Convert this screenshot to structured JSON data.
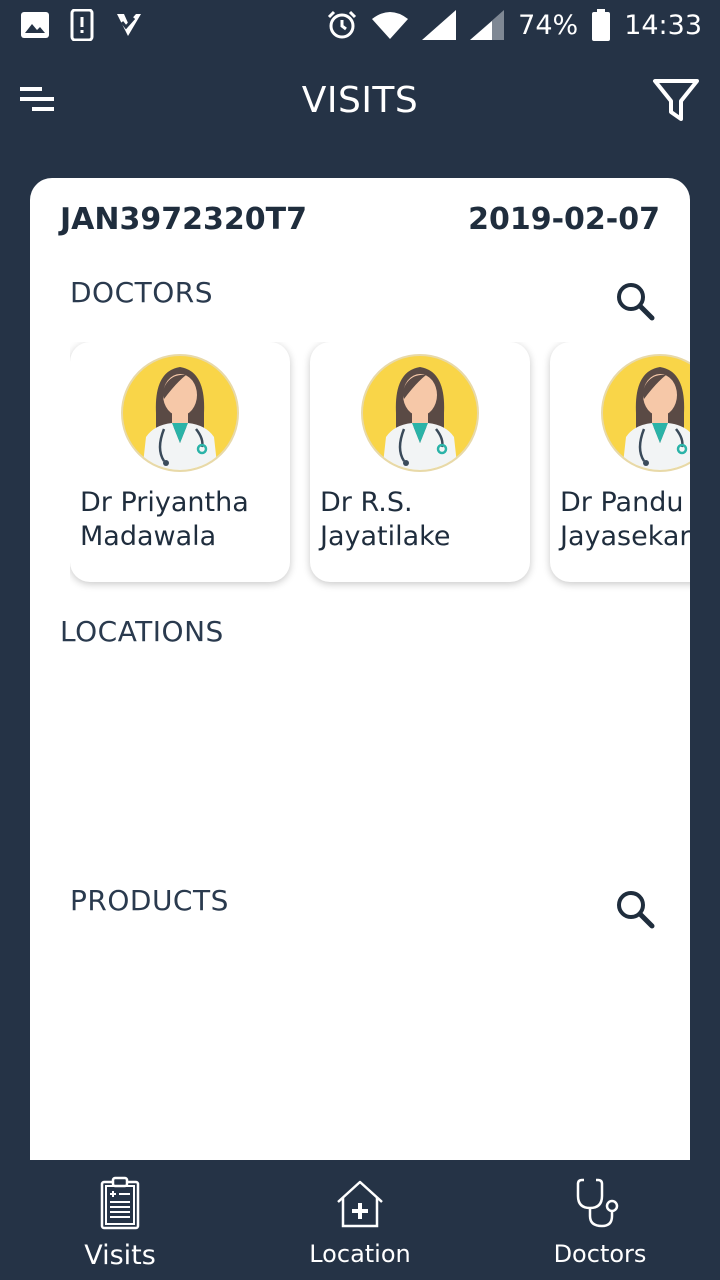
{
  "status_bar": {
    "battery": "74%",
    "time": "14:33",
    "left_icons": [
      "image-icon",
      "phone-alert-icon",
      "check-task-icon"
    ],
    "right_icons": [
      "alarm-icon",
      "wifi-icon",
      "signal-icon",
      "signal-icon",
      "battery-icon"
    ]
  },
  "app_bar": {
    "title": "VISITS",
    "menu_icon": "menu-icon",
    "filter_icon": "filter-icon"
  },
  "visit": {
    "code": "JAN3972320T7",
    "date": "2019-02-07"
  },
  "sections": {
    "doctors": "DOCTORS",
    "locations": "LOCATIONS",
    "products": "PRODUCTS"
  },
  "doctors": [
    {
      "line1": "Dr Priyantha",
      "line2": "Madawala"
    },
    {
      "line1": "Dr R.S.",
      "line2": "Jayatilake"
    },
    {
      "line1": "Dr Pandu",
      "line2": "Jayasekara"
    }
  ],
  "bottom_nav": [
    {
      "label": "Visits",
      "icon": "clipboard-icon",
      "active": true
    },
    {
      "label": "Location",
      "icon": "hospital-icon",
      "active": false
    },
    {
      "label": "Doctors",
      "icon": "stethoscope-icon",
      "active": false
    }
  ],
  "colors": {
    "background": "#253346",
    "card": "#ffffff",
    "text": "#1f2d3d",
    "avatar_bg": "#f9d548"
  }
}
